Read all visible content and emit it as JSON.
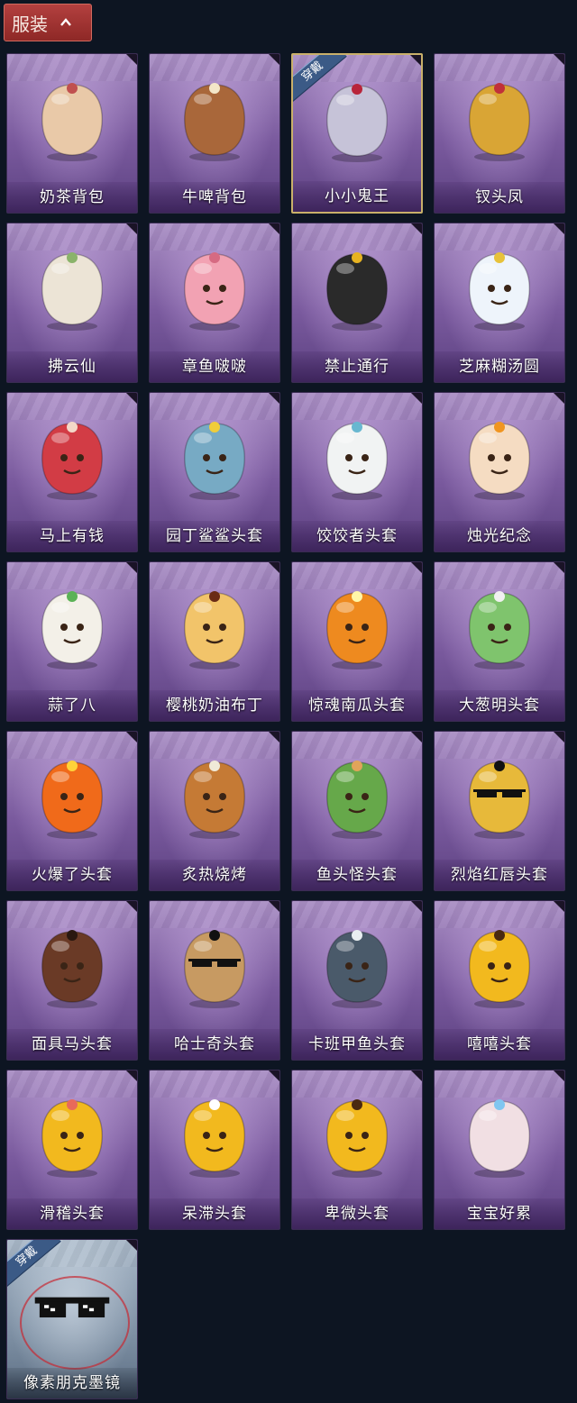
{
  "header": {
    "label": "服装",
    "chevron_icon": "chevron-up-icon"
  },
  "equipped_badge": "穿戴",
  "items": [
    {
      "name": "奶茶背包",
      "icon": "backpack-milktea-icon",
      "color": "#e9c9a8",
      "accent": "#c0504f",
      "equipped": false
    },
    {
      "name": "牛啤背包",
      "icon": "backpack-beer-icon",
      "color": "#a9673a",
      "accent": "#f3e6c8",
      "equipped": false
    },
    {
      "name": "小小鬼王",
      "icon": "ghost-king-figure-icon",
      "color": "#c6c3d8",
      "accent": "#b8243a",
      "equipped": true
    },
    {
      "name": "钗头凤",
      "icon": "phoenix-crown-figure-icon",
      "color": "#d9a535",
      "accent": "#c0303a",
      "equipped": false
    },
    {
      "name": "拂云仙",
      "icon": "cloud-fairy-charm-icon",
      "color": "#ece4d6",
      "accent": "#8ab36a",
      "equipped": false
    },
    {
      "name": "章鱼啵啵",
      "icon": "octopus-icon",
      "color": "#f2a2b3",
      "accent": "#d66a82",
      "equipped": false
    },
    {
      "name": "禁止通行",
      "icon": "no-entry-cone-icon",
      "color": "#2a2a2a",
      "accent": "#e7b321",
      "equipped": false
    },
    {
      "name": "芝麻糊汤圆",
      "icon": "rice-ball-icon",
      "color": "#eef4fb",
      "accent": "#e7c23a",
      "equipped": false
    },
    {
      "name": "马上有钱",
      "icon": "red-horse-head-icon",
      "color": "#d23c45",
      "accent": "#f3d8c8",
      "equipped": false
    },
    {
      "name": "园丁鲨鲨头套",
      "icon": "shark-bee-head-icon",
      "color": "#77aac4",
      "accent": "#f0cd3a",
      "equipped": false
    },
    {
      "name": "饺饺者头套",
      "icon": "cloud-dumpling-head-icon",
      "color": "#f1f3f3",
      "accent": "#68b7d0",
      "equipped": false
    },
    {
      "name": "烛光纪念",
      "icon": "candle-head-icon",
      "color": "#f5dcc2",
      "accent": "#f09520",
      "equipped": false
    },
    {
      "name": "蒜了八",
      "icon": "garlic-head-icon",
      "color": "#f3f0e8",
      "accent": "#5bb256",
      "equipped": false
    },
    {
      "name": "樱桃奶油布丁",
      "icon": "pudding-head-icon",
      "color": "#f2c46a",
      "accent": "#6a2b16",
      "equipped": false
    },
    {
      "name": "惊魂南瓜头套",
      "icon": "pumpkin-head-icon",
      "color": "#ee8a1f",
      "accent": "#fff6a8",
      "equipped": false
    },
    {
      "name": "大葱明头套",
      "icon": "scallion-head-icon",
      "color": "#7fc46d",
      "accent": "#f0f0f0",
      "equipped": false
    },
    {
      "name": "火爆了头套",
      "icon": "fire-head-icon",
      "color": "#f06a1a",
      "accent": "#ffd23a",
      "equipped": false
    },
    {
      "name": "炙热烧烤",
      "icon": "meat-bone-head-icon",
      "color": "#c57a35",
      "accent": "#f0ead8",
      "equipped": false
    },
    {
      "name": "鱼头怪头套",
      "icon": "fish-mask-icon",
      "color": "#66a84a",
      "accent": "#e0a45a",
      "equipped": false
    },
    {
      "name": "烈焰红唇头套",
      "icon": "yellow-mask-sunglasses-icon",
      "color": "#e7b93a",
      "accent": "#111111",
      "equipped": false
    },
    {
      "name": "面具马头套",
      "icon": "horse-mask-icon",
      "color": "#6a3a26",
      "accent": "#2a1810",
      "equipped": false
    },
    {
      "name": "哈士奇头套",
      "icon": "husky-sunglasses-icon",
      "color": "#c79a62",
      "accent": "#111111",
      "equipped": false
    },
    {
      "name": "卡班甲鱼头套",
      "icon": "seal-head-icon",
      "color": "#4a5a6a",
      "accent": "#e8eef0",
      "equipped": false
    },
    {
      "name": "嘻嘻头套",
      "icon": "grinning-emoji-icon",
      "color": "#f2b91e",
      "accent": "#4a2a10",
      "equipped": false
    },
    {
      "name": "滑稽头套",
      "icon": "funny-emoji-icon",
      "color": "#f2b91e",
      "accent": "#e86a5a",
      "equipped": false
    },
    {
      "name": "呆滞头套",
      "icon": "dazed-emoji-icon",
      "color": "#f2b91e",
      "accent": "#ffffff",
      "equipped": false
    },
    {
      "name": "卑微头套",
      "icon": "humble-emoji-icon",
      "color": "#f2b91e",
      "accent": "#4a2a10",
      "equipped": false
    },
    {
      "name": "宝宝好累",
      "icon": "tired-baby-icon",
      "color": "#f1dfe3",
      "accent": "#7fc6f0",
      "equipped": false
    },
    {
      "name": "像素朋克墨镜",
      "icon": "pixel-sunglasses-icon",
      "color": "#111111",
      "accent": "#ffffff",
      "equipped": true,
      "grey": true
    }
  ]
}
